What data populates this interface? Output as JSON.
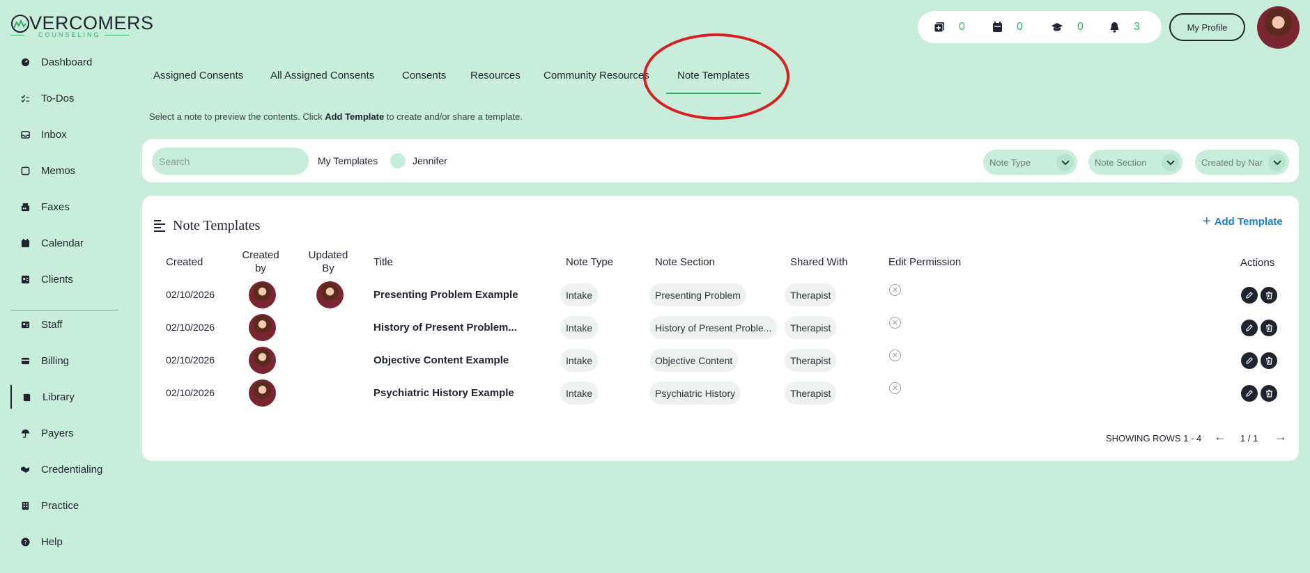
{
  "logo": {
    "word": "VERCOMERS",
    "sub": "COUNSELING"
  },
  "sidebar": {
    "items": [
      {
        "label": "Dashboard",
        "icon": "dashboard-icon"
      },
      {
        "label": "To-Dos",
        "icon": "checklist-icon"
      },
      {
        "label": "Inbox",
        "icon": "inbox-icon"
      },
      {
        "label": "Memos",
        "icon": "memo-icon"
      },
      {
        "label": "Faxes",
        "icon": "fax-icon"
      },
      {
        "label": "Calendar",
        "icon": "calendar-icon"
      },
      {
        "label": "Clients",
        "icon": "clients-icon"
      },
      {
        "label": "Staff",
        "icon": "staff-icon"
      },
      {
        "label": "Billing",
        "icon": "billing-icon"
      },
      {
        "label": "Library",
        "icon": "library-icon"
      },
      {
        "label": "Payers",
        "icon": "umbrella-icon"
      },
      {
        "label": "Credentialing",
        "icon": "handshake-icon"
      },
      {
        "label": "Practice",
        "icon": "building-icon"
      },
      {
        "label": "Help",
        "icon": "help-icon"
      }
    ],
    "active": "Library"
  },
  "header": {
    "stats": [
      {
        "icon": "add-note-icon",
        "count": "0"
      },
      {
        "icon": "calendar-icon",
        "count": "0"
      },
      {
        "icon": "graduation-cap-icon",
        "count": "0"
      },
      {
        "icon": "bell-icon",
        "count": "3"
      }
    ],
    "profile_label": "My Profile"
  },
  "tabs": [
    {
      "label": "Assigned Consents"
    },
    {
      "label": "All Assigned Consents"
    },
    {
      "label": "Consents"
    },
    {
      "label": "Resources"
    },
    {
      "label": "Community Resources"
    },
    {
      "label": "Note Templates",
      "active": true
    }
  ],
  "hint": {
    "before": "Select a note to preview the contents. Click ",
    "bold": "Add Template",
    "after": " to create and/or share a template."
  },
  "filters": {
    "search_placeholder": "Search",
    "my_templates_label": "My Templates",
    "user_label": "Jennifer",
    "dropdowns": [
      "Note Type",
      "Note Section",
      "Created by Nar"
    ]
  },
  "card": {
    "title": "Note Templates",
    "add_label": "Add Template",
    "columns": {
      "created": "Created",
      "created_by": "Created by",
      "updated_by": "Updated By",
      "title": "Title",
      "note_type": "Note Type",
      "note_section": "Note Section",
      "shared_with": "Shared With",
      "edit_permission": "Edit Permission",
      "actions": "Actions"
    },
    "rows": [
      {
        "created": "02/10/2026",
        "title": "Presenting Problem Example",
        "note_type": "Intake",
        "note_section": "Presenting Problem",
        "shared_with": "Therapist",
        "updated": true
      },
      {
        "created": "02/10/2026",
        "title": "History of Present Problem...",
        "note_type": "Intake",
        "note_section": "History of Present Proble...",
        "shared_with": "Therapist",
        "updated": false
      },
      {
        "created": "02/10/2026",
        "title": "Objective Content Example",
        "note_type": "Intake",
        "note_section": "Objective Content",
        "shared_with": "Therapist",
        "updated": false
      },
      {
        "created": "02/10/2026",
        "title": "Psychiatric History Example",
        "note_type": "Intake",
        "note_section": "Psychiatric History",
        "shared_with": "Therapist",
        "updated": false
      }
    ],
    "pager": {
      "rows_text": "SHOWING ROWS 1 - 4",
      "page_text": "1 / 1"
    }
  },
  "colors": {
    "background": "#c8eddb",
    "accent_green": "#2fae64",
    "link_blue": "#1a7fd0",
    "annotation_red": "#d81f1f"
  }
}
